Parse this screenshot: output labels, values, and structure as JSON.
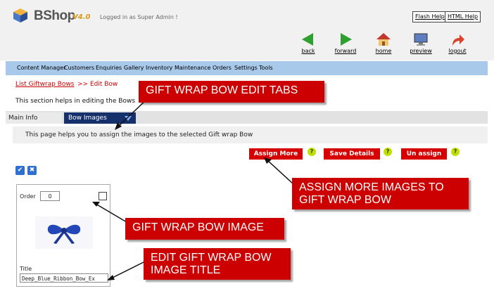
{
  "header": {
    "brand": "BShop",
    "version": "V4.0",
    "logged_in": "Logged in as Super Admin !",
    "flash_help": "Flash Help",
    "html_help": "HTML Help"
  },
  "toolbar": {
    "back": "back",
    "forward": "forward",
    "home": "home",
    "preview": "preview",
    "logout": "logout"
  },
  "menu": {
    "items": [
      "Content Manager",
      "Customers",
      "Enquiries",
      "Gallery",
      "Inventory",
      "Maintenance",
      "Orders",
      "Settings",
      "Tools"
    ]
  },
  "breadcrumb": {
    "link": "List Giftwrap Bows",
    "current": ">> Edit Bow"
  },
  "section_help": "This section helps in editing the Bows",
  "tabs": {
    "main_info": "Main Info",
    "bow_images": "Bow Images"
  },
  "page_help": "This page helps you to assign the images to the selected Gift wrap Bow",
  "actions": {
    "assign_more": "Assign More",
    "save_details": "Save Details",
    "un_assign": "Un assign",
    "help_mark": "?",
    "check_all": "✔",
    "uncheck_all": "✖"
  },
  "image_card": {
    "order_label": "Order",
    "order_value": "0",
    "title_label": "Title",
    "title_value": "Deep_Blue_Ribbon_Bow_Ex"
  },
  "callouts": {
    "tabs": "GIFT WRAP BOW EDIT TABS",
    "assign_line1": "ASSIGN MORE IMAGES TO",
    "assign_line2": "GIFT WRAP BOW",
    "image": "GIFT WRAP BOW IMAGE",
    "title_line1": "EDIT GIFT WRAP BOW",
    "title_line2": "IMAGE TITLE"
  },
  "colors": {
    "callout_red": "#cc0000",
    "button_red": "#d60000",
    "menu_blue": "#a9c9ea",
    "tab_active": "#16306b"
  }
}
